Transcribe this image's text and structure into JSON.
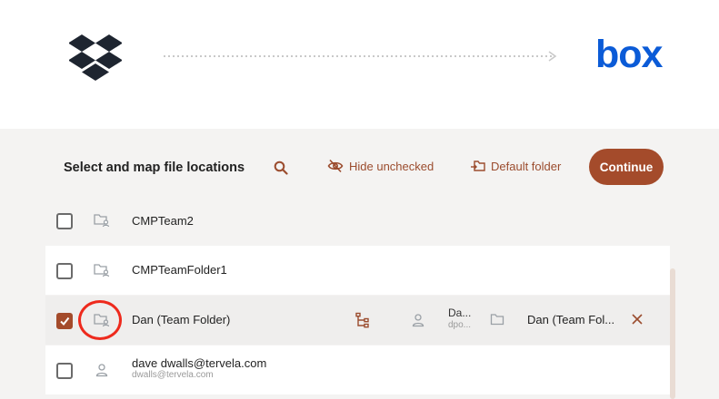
{
  "header": {
    "source_logo": "dropbox-icon",
    "destination_logo_text": "box"
  },
  "toolbar": {
    "title": "Select and map file locations",
    "search_icon": "search-icon",
    "hide_unchecked_label": "Hide unchecked",
    "default_folder_label": "Default folder",
    "continue_label": "Continue"
  },
  "rows": [
    {
      "type": "team-folder",
      "checked": false,
      "name": "CMPTeam2"
    },
    {
      "type": "team-folder",
      "checked": false,
      "name": "CMPTeamFolder1"
    },
    {
      "type": "team-folder",
      "checked": true,
      "name": "Dan (Team Folder)",
      "destination": {
        "user": "Da...",
        "email": "dpo...",
        "folder": "Dan (Team Fol..."
      }
    },
    {
      "type": "user",
      "checked": false,
      "name": "dave dwalls@tervela.com",
      "sub": "dwalls@tervela.com"
    }
  ],
  "colors": {
    "accent": "#a44b2b",
    "box_blue": "#0b5bd7",
    "highlight": "#ee2a1d"
  }
}
